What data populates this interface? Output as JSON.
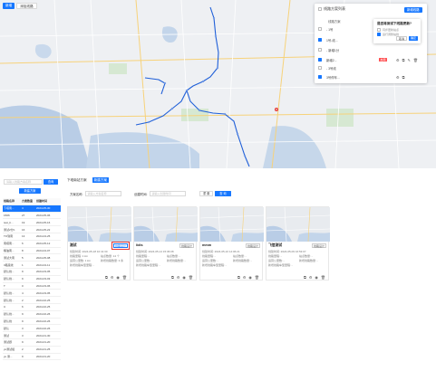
{
  "map_toolbar": {
    "primary_label": "新增",
    "secondary_label": "添加线路"
  },
  "panel": {
    "title": "线路方案列表",
    "new_label": "新增线路",
    "col_header": "线路方案",
    "rows": [
      {
        "label": "- 1号",
        "checked": false,
        "tag": "",
        "tag_kind": ""
      },
      {
        "label": "1号-线...",
        "checked": true,
        "tag": "",
        "tag_kind": ""
      },
      {
        "label": "- 新增1分",
        "checked": false,
        "tag": "",
        "tag_kind": ""
      },
      {
        "label": "新增2...",
        "checked": true,
        "tag": "启用",
        "tag_kind": "off"
      },
      {
        "label": "- 3号线",
        "checked": false,
        "tag": "",
        "tag_kind": ""
      },
      {
        "label": "3号停车...",
        "checked": true,
        "tag": "",
        "tag_kind": ""
      }
    ],
    "popover": {
      "question": "是否将测试下线路更新?",
      "option1": "同步更新站点",
      "option2": "运行调整站线",
      "cancel": "取消",
      "ok": "确定"
    }
  },
  "left": {
    "search_placeholder": "请输入线路方案名称",
    "search_label": "查询",
    "new_label": "新建方案",
    "headers": [
      "线路名称",
      "方案数量",
      "创建时间"
    ],
    "rows": [
      [
        "下塔南...",
        "4",
        "2024-05-30"
      ],
      [
        "1506",
        "27",
        "2024-05-06"
      ],
      [
        "test_b...",
        "19",
        "2024-05-16"
      ],
      [
        "测试2分b",
        "16",
        "2024-05-22"
      ],
      [
        "TO到南",
        "13",
        "2024-04-25"
      ],
      [
        "南塔南...",
        "6",
        "2024-05-12"
      ],
      [
        "粮油南...",
        "8",
        "2024-04-07"
      ],
      [
        "测试大南",
        "5",
        "2024-05-08"
      ],
      [
        "3路延线",
        "1",
        "2024-04-11"
      ],
      [
        "默认线...",
        "9",
        "2024-03-05"
      ],
      [
        "默认线...",
        "9",
        "2024-03-03"
      ],
      [
        "T",
        "0",
        "2024-03-06"
      ],
      [
        "默认线...",
        "4",
        "2024-03-05"
      ],
      [
        "默认线...",
        "2",
        "2024-02-25"
      ],
      [
        "U",
        "6",
        "2024-02-25"
      ],
      [
        "默认线...",
        "9",
        "2024-02-26"
      ],
      [
        "默认线",
        "9",
        "2024-02-26"
      ],
      [
        "默认",
        "3",
        "2024-02-26"
      ],
      [
        "测试",
        "3",
        "2024-01-30"
      ],
      [
        "测试题",
        "9",
        "2024-01-20"
      ],
      [
        "yu测试组",
        "2",
        "2024-01-25"
      ],
      [
        "yu 测...",
        "9",
        "2024-01-20"
      ]
    ],
    "selected_index": 0
  },
  "right": {
    "tab_plain": "下塔南站方案",
    "tab_active": "新建方案",
    "filter": {
      "name_label": "方案名称:",
      "name_placeholder": "请输入方案名称",
      "creator_label": "创建时间:",
      "creator_placeholder": "请输入创建时间",
      "reset_label": "重 置",
      "query_label": "查 询"
    },
    "cards": [
      {
        "name": "测试",
        "tag": "线路设计",
        "highlight": true,
        "meta1_l": "创建时间: 2024-05-18 10:41:30",
        "meta2_l": "线路里程: 1 km",
        "meta2_r": "站点数量: 14 个",
        "meta3_l": "运营公里数: 1 km",
        "meta3_r": "新增线路数量: 3 条",
        "meta4_l": "新增线路车型里程: -"
      },
      {
        "name": "lidis",
        "tag": "线路设计",
        "highlight": false,
        "meta1_l": "创建时间: 2024-05-14 15:36:08",
        "meta2_l": "线路里程: -",
        "meta2_r": "站点数量: -",
        "meta3_l": "运营公里数: -",
        "meta3_r": "新增线路数量: -",
        "meta4_l": "新增线路车型里程: -"
      },
      {
        "name": "mmm",
        "tag": "线路设计",
        "highlight": false,
        "meta1_l": "创建时间: 2024-05-10 14:06:21",
        "meta2_l": "线路里程: -",
        "meta2_r": "站点数量: -",
        "meta3_l": "运营公里数: -",
        "meta3_r": "新增线路数量: -",
        "meta4_l": "新增线路车型里程: -"
      },
      {
        "name": "飞信测试",
        "tag": "线路设计",
        "highlight": false,
        "meta1_l": "创建时间: 2024-05-09 16:53:07",
        "meta2_l": "线路里程: -",
        "meta2_r": "站点数量: -",
        "meta3_l": "运营公里数: -",
        "meta3_r": "新增线路数量: -",
        "meta4_l": "新增线路车型里程: -"
      }
    ]
  }
}
